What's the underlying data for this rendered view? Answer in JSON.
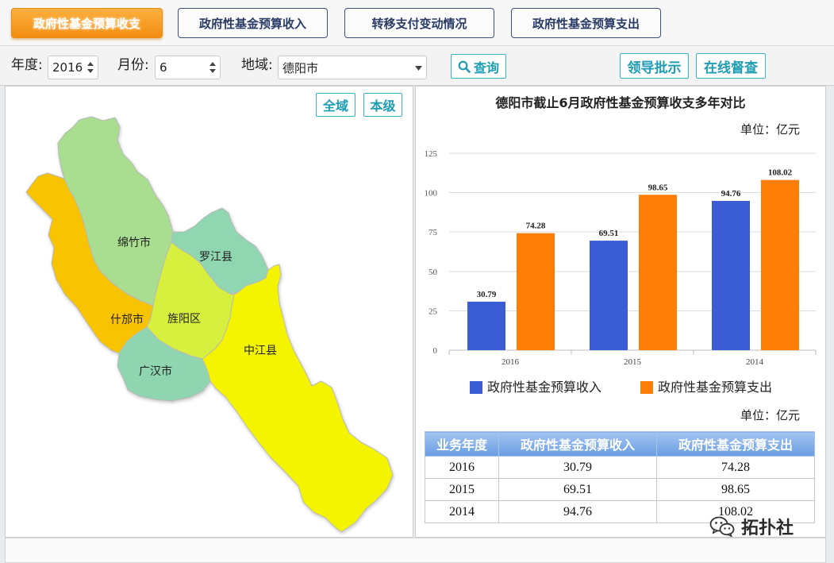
{
  "tabs": [
    {
      "label": "政府性基金预算收支",
      "active": true
    },
    {
      "label": "政府性基金预算收入",
      "active": false
    },
    {
      "label": "转移支付变动情况",
      "active": false
    },
    {
      "label": "政府性基金预算支出",
      "active": false
    }
  ],
  "filters": {
    "year_label": "年度:",
    "year_value": "2016",
    "month_label": "月份:",
    "month_value": "6",
    "region_label": "地域:",
    "region_value": "德阳市",
    "query_button": "查询"
  },
  "actions": {
    "leader_button": "领导批示",
    "supervise_button": "在线督查"
  },
  "map": {
    "scope_all": "全域",
    "scope_local": "本级",
    "regions": [
      {
        "name": "绵竹市",
        "color": "#a9dd8f"
      },
      {
        "name": "什邡市",
        "color": "#f8c300"
      },
      {
        "name": "罗江县",
        "color": "#8fd6b1"
      },
      {
        "name": "旌阳区",
        "color": "#d7ef3d"
      },
      {
        "name": "广汉市",
        "color": "#8fd5b0"
      },
      {
        "name": "中江县",
        "color": "#f4f400"
      }
    ]
  },
  "chart_data": {
    "type": "bar",
    "title": "德阳市截止6月政府性基金预算收支多年对比",
    "unit": "单位：亿元",
    "categories": [
      "2016",
      "2015",
      "2014"
    ],
    "series": [
      {
        "name": "政府性基金预算收入",
        "color": "#3a5cd4",
        "values": [
          30.79,
          69.51,
          94.76
        ]
      },
      {
        "name": "政府性基金预算支出",
        "color": "#fd7e06",
        "values": [
          74.28,
          98.65,
          108.02
        ]
      }
    ],
    "yticks": [
      0,
      25,
      50,
      75,
      100,
      125
    ],
    "ylim": [
      0,
      125
    ],
    "xlabel": "",
    "ylabel": "",
    "grid": true,
    "legend": "bottom"
  },
  "table": {
    "unit": "单位：亿元",
    "headers": [
      "业务年度",
      "政府性基金预算收入",
      "政府性基金预算支出"
    ],
    "rows": [
      [
        "2016",
        "30.79",
        "74.28"
      ],
      [
        "2015",
        "69.51",
        "98.65"
      ],
      [
        "2014",
        "94.76",
        "108.02"
      ]
    ]
  },
  "watermark": {
    "text": "拓扑社",
    "icon": "wechat-icon"
  },
  "icons": {
    "query": "search-icon",
    "year_select": "spinner-arrows-icon",
    "month_select": "spinner-arrows-icon",
    "region_select": "caret-down-icon"
  },
  "colors": {
    "button_text": "#1c9db3",
    "button_border": "#35b6c9",
    "active_tab_top": "#fbb040",
    "active_tab_bottom": "#f38d10",
    "table_header_top": "#a2c4f1",
    "table_header_bottom": "#6a9de2"
  }
}
